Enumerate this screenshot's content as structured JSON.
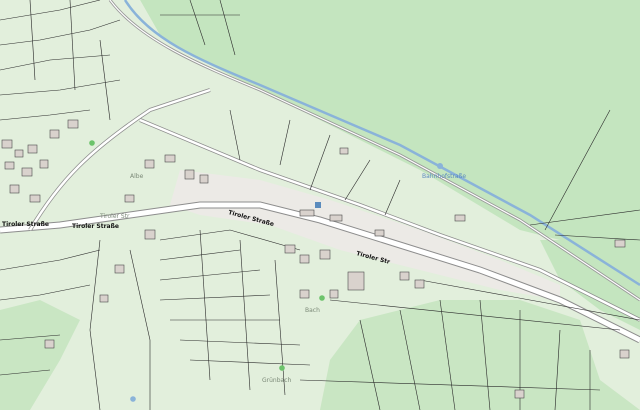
{
  "map": {
    "colors": {
      "forest": "#c4e5bf",
      "meadow": "#e2efdc",
      "settlement": "#eceae6",
      "road": "#ffffff",
      "road_casing": "#8d8d8d",
      "parcel_line": "#2a2a2a",
      "water": "#8ab3d9",
      "building": "#d9d2cd"
    },
    "labels": {
      "tiroler_strasse_w": "Tiroler Straße",
      "tiroler_str_short": "Tiroler Str",
      "tiroler_strasse_center": "Tiroler Straße",
      "tiroler_strasse_mid": "Tiroler Straße",
      "tiroler_strasse_east": "Tiroler Str",
      "place_north_west": "Albe",
      "place_station": "Bahnhofstraße",
      "creek_label": "Bach",
      "place_south": "Grünbach"
    },
    "icons": [
      "water-drop-icon",
      "tree-icon",
      "bus-stop-icon",
      "church-icon"
    ]
  }
}
